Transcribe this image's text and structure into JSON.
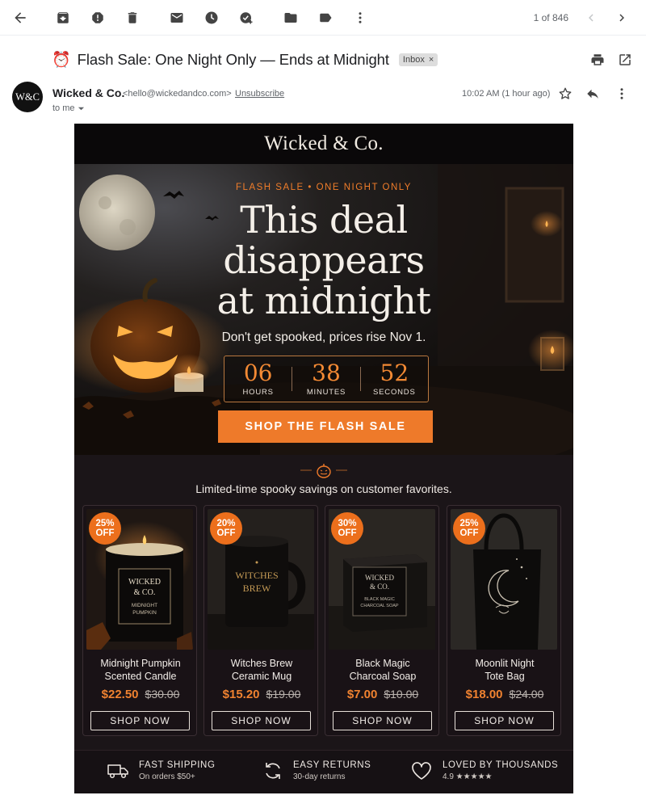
{
  "toolbar": {
    "pager": "1 of 846"
  },
  "message": {
    "subject_emoji": "⏰",
    "subject": "Flash Sale: One Night Only — Ends at Midnight",
    "label": "Inbox",
    "label_close": "×",
    "avatar_text": "W&C",
    "sender_name": "Wicked & Co.",
    "sender_email": "<hello@wickedandco.com>",
    "unsubscribe": "Unsubscribe",
    "to": "to me",
    "timestamp": "10:02 AM (1 hour ago)"
  },
  "email": {
    "brand": "Wicked & Co.",
    "eyebrow": "FLASH SALE • ONE NIGHT ONLY",
    "headline": [
      "This deal",
      "disappears",
      "at midnight"
    ],
    "subheadline": "Don't get spooked, prices rise Nov 1.",
    "countdown": [
      {
        "value": "06",
        "label": "HOURS"
      },
      {
        "value": "38",
        "label": "MINUTES"
      },
      {
        "value": "52",
        "label": "SECONDS"
      }
    ],
    "cta": "SHOP THE FLASH SALE",
    "tagline": "Limited-time spooky savings on customer favorites.",
    "products": [
      {
        "badge_pct": "25%",
        "badge_off": "OFF",
        "name_1": "Midnight Pumpkin",
        "name_2": "Scented Candle",
        "price": "$22.50",
        "was": "$30.00",
        "button": "SHOP NOW",
        "image_text": [
          "WICKED",
          "& CO.",
          "MIDNIGHT",
          "PUMPKIN"
        ]
      },
      {
        "badge_pct": "20%",
        "badge_off": "OFF",
        "name_1": "Witches Brew",
        "name_2": "Ceramic Mug",
        "price": "$15.20",
        "was": "$19.00",
        "button": "SHOP NOW",
        "image_text": [
          "WITCHES",
          "BREW"
        ]
      },
      {
        "badge_pct": "30%",
        "badge_off": "OFF",
        "name_1": "Black Magic",
        "name_2": "Charcoal Soap",
        "price": "$7.00",
        "was": "$10.00",
        "button": "SHOP NOW",
        "image_text": [
          "WICKED",
          "& CO.",
          "BLACK MAGIC",
          "CHARCOAL SOAP"
        ]
      },
      {
        "badge_pct": "25%",
        "badge_off": "OFF",
        "name_1": "Moonlit Night",
        "name_2": "Tote Bag",
        "price": "$18.00",
        "was": "$24.00",
        "button": "SHOP NOW",
        "image_text": []
      }
    ],
    "features": [
      {
        "icon": "truck-icon",
        "title": "FAST SHIPPING",
        "sub": "On orders $50+"
      },
      {
        "icon": "refresh-icon",
        "title": "EASY RETURNS",
        "sub": "30-day returns"
      },
      {
        "icon": "heart-icon",
        "title": "LOVED BY THOUSANDS",
        "sub": "4.9 ★★★★★"
      }
    ]
  },
  "colors": {
    "accent": "#ee7a2a",
    "email_bg": "#1b1518",
    "brand_bar": "#0a0809"
  }
}
